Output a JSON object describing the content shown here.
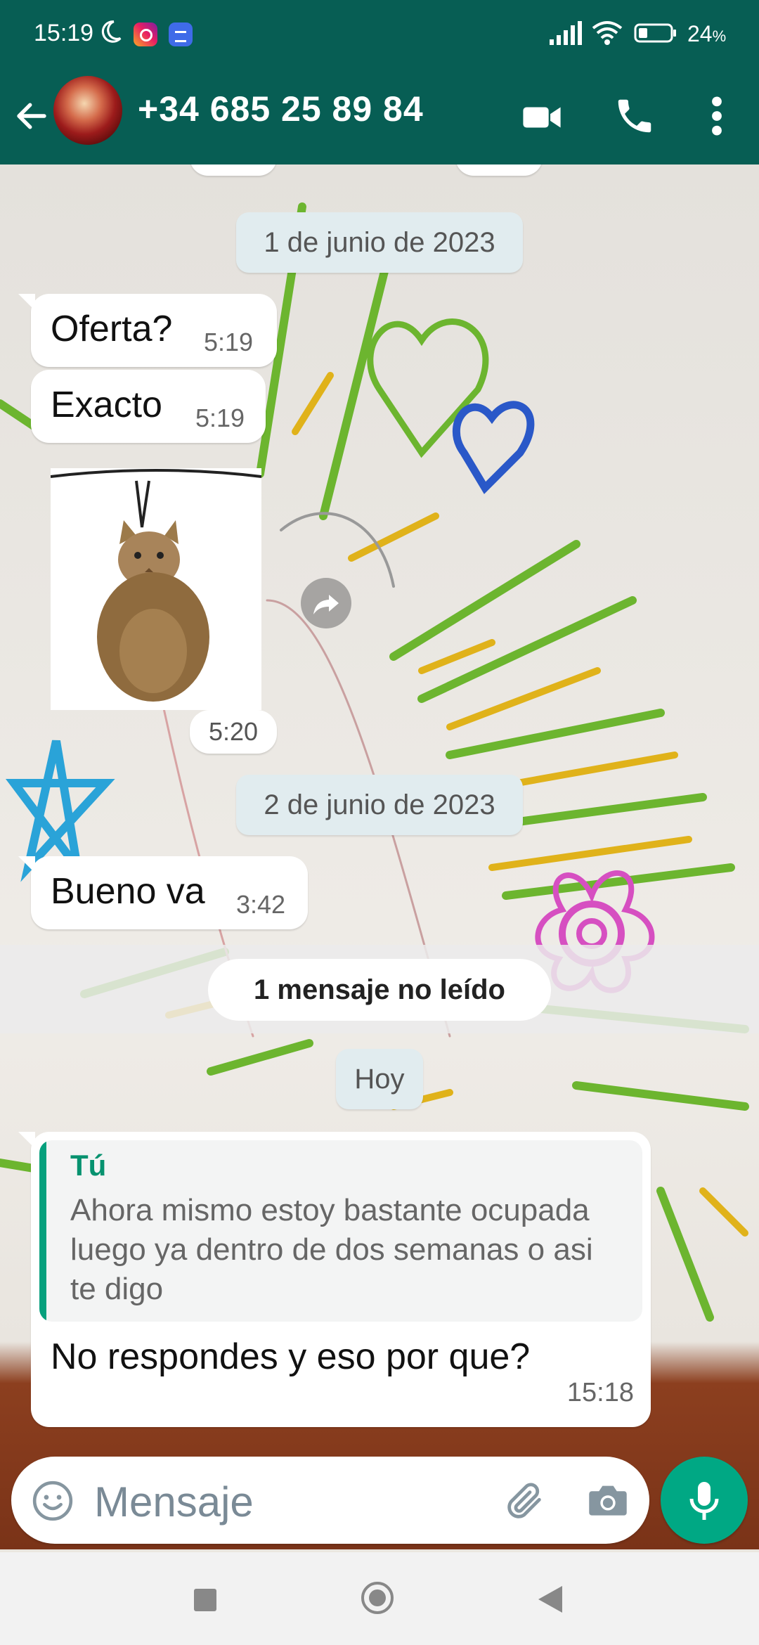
{
  "status_bar": {
    "time": "15:19",
    "battery_percent": "24",
    "battery_unit": "%",
    "icons": [
      "moon-icon",
      "instagram-icon",
      "messages-app-icon",
      "signal-icon",
      "wifi-icon",
      "battery-icon"
    ]
  },
  "header": {
    "contact_name": "+34 685 25 89 84",
    "icons": [
      "back-arrow-icon",
      "video-call-icon",
      "phone-call-icon",
      "more-options-icon"
    ]
  },
  "chat": {
    "date_1": "1 de junio de 2023",
    "messages_day1": [
      {
        "text": "Oferta?",
        "time": "5:19"
      },
      {
        "text": "Exacto",
        "time": "5:19"
      }
    ],
    "sticker_time": "5:20",
    "date_2": "2 de junio de 2023",
    "message_day2": {
      "text": "Bueno va",
      "time": "3:42"
    },
    "unread_banner": "1 mensaje no leído",
    "date_3": "Hoy",
    "reply_message": {
      "quote_author": "Tú",
      "quote_text": "Ahora mismo estoy bastante ocupada luego ya dentro de dos semanas o asi te digo",
      "text": "No respondes y eso por que?",
      "time": "15:18"
    }
  },
  "composer": {
    "placeholder": "Mensaje",
    "icons": [
      "emoji-icon",
      "attach-icon",
      "camera-icon",
      "mic-icon"
    ]
  },
  "colors": {
    "header": "#075e54",
    "accent": "#00a884",
    "quote_author": "#06926f"
  }
}
